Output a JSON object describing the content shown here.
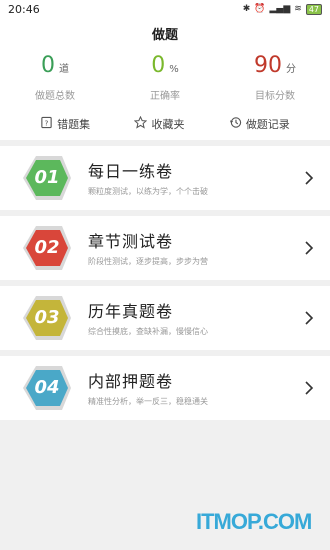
{
  "status": {
    "time": "20:46",
    "battery": "47"
  },
  "page_title": "做题",
  "stats": [
    {
      "value": "0",
      "unit": "道",
      "label": "做题总数",
      "color": "#3a9e57"
    },
    {
      "value": "0",
      "unit": "%",
      "label": "正确率",
      "color": "#7ab82c"
    },
    {
      "value": "90",
      "unit": "分",
      "label": "目标分数",
      "color": "#c0392b"
    }
  ],
  "quick_links": [
    {
      "label": "错题集",
      "icon": "wrong-book-icon"
    },
    {
      "label": "收藏夹",
      "icon": "star-icon"
    },
    {
      "label": "做题记录",
      "icon": "history-icon"
    }
  ],
  "cards": [
    {
      "num": "01",
      "title": "每日一练卷",
      "sub": "颗粒度测试，以练为学，个个击破",
      "color": "#5cb85c"
    },
    {
      "num": "02",
      "title": "章节测试卷",
      "sub": "阶段性测试，逐步提高，步步为营",
      "color": "#d9463a"
    },
    {
      "num": "03",
      "title": "历年真题卷",
      "sub": "综合性摸底，查缺补漏，慢慢信心",
      "color": "#c4b53a"
    },
    {
      "num": "04",
      "title": "内部押题卷",
      "sub": "精准性分析，举一反三，稳稳通关",
      "color": "#4aa8c8"
    }
  ],
  "watermark": "ITMOP.COM"
}
